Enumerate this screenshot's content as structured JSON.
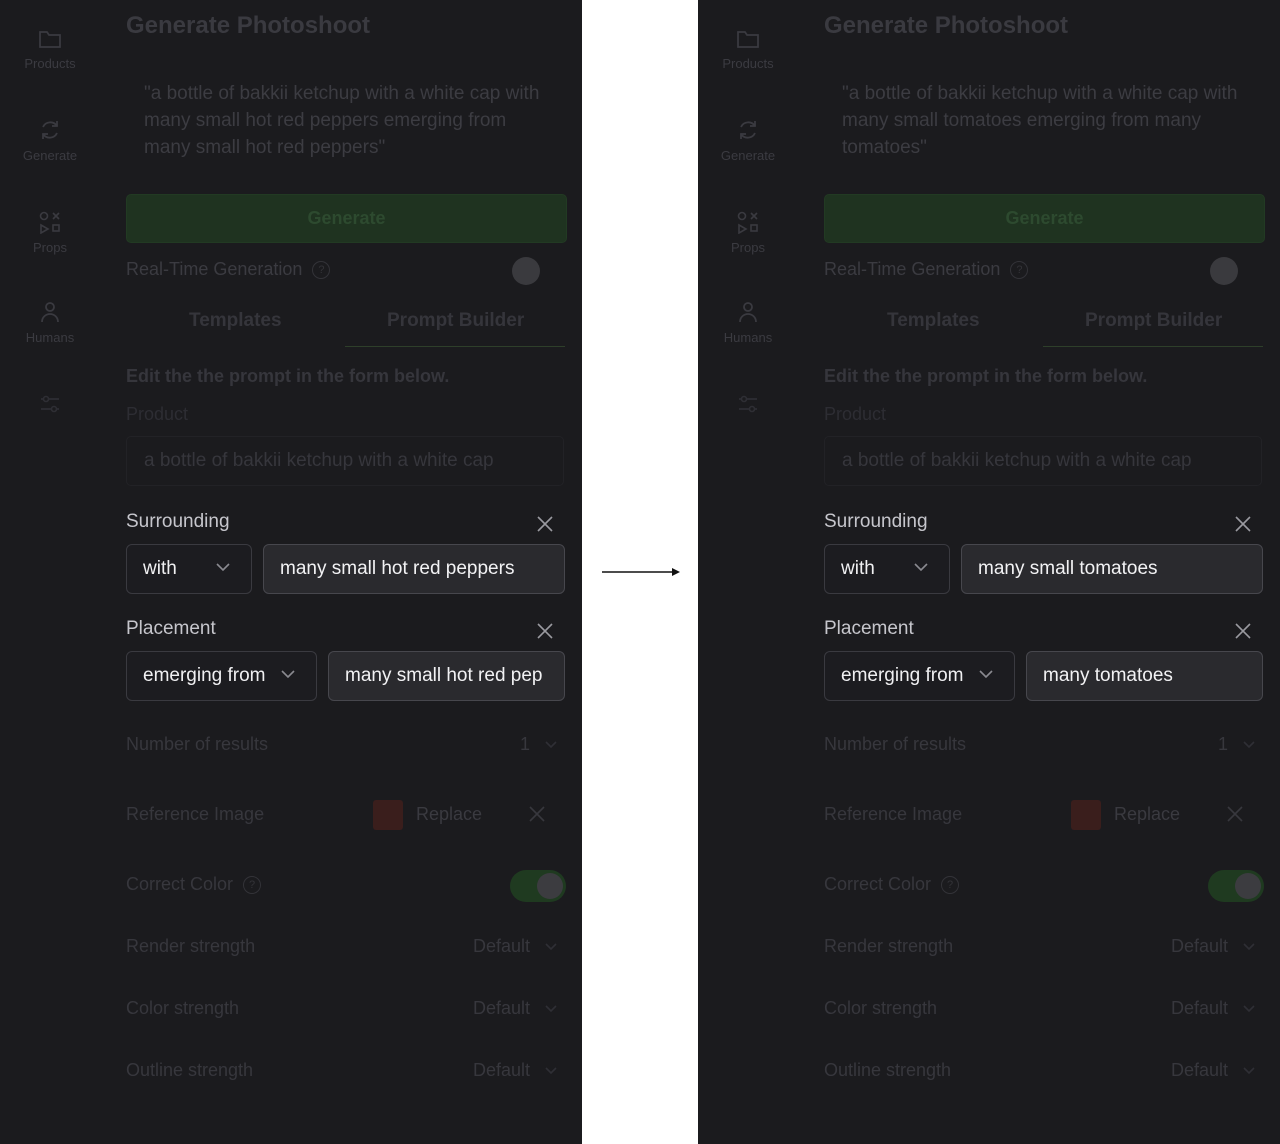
{
  "sidebar": {
    "items": [
      {
        "label": "Products",
        "icon": "folder-icon"
      },
      {
        "label": "Generate",
        "icon": "refresh-icon"
      },
      {
        "label": "Props",
        "icon": "shapes-icon"
      },
      {
        "label": "Humans",
        "icon": "person-icon"
      },
      {
        "label": "",
        "icon": "sliders-icon"
      }
    ]
  },
  "panels": [
    {
      "title": "Generate Photoshoot",
      "prompt": "\"a bottle of bakkii ketchup with a white cap with many small hot red peppers emerging from many small hot red peppers\"",
      "generate_label": "Generate",
      "realtime_label": "Real-Time Generation",
      "help_glyph": "?",
      "tabs": [
        "Templates",
        "Prompt Builder"
      ],
      "edit_hint": "Edit the the prompt in the form below.",
      "product_label": "Product",
      "product_value": "a bottle of bakkii ketchup with a white cap",
      "surrounding": {
        "label": "Surrounding",
        "select": "with",
        "value": "many small hot red peppers"
      },
      "placement": {
        "label": "Placement",
        "select": "emerging from",
        "value": "many small hot red pep"
      },
      "number_of_results": {
        "label": "Number of results",
        "value": "1"
      },
      "reference_image": {
        "label": "Reference Image",
        "action": "Replace"
      },
      "correct_color": {
        "label": "Correct Color"
      },
      "render_strength": {
        "label": "Render strength",
        "value": "Default"
      },
      "color_strength": {
        "label": "Color strength",
        "value": "Default"
      },
      "outline_strength": {
        "label": "Outline strength",
        "value": "Default"
      }
    },
    {
      "title": "Generate Photoshoot",
      "prompt": "\"a bottle of bakkii ketchup with a white cap with many small tomatoes emerging from many tomatoes\"",
      "generate_label": "Generate",
      "realtime_label": "Real-Time Generation",
      "help_glyph": "?",
      "tabs": [
        "Templates",
        "Prompt Builder"
      ],
      "edit_hint": "Edit the the prompt in the form below.",
      "product_label": "Product",
      "product_value": "a bottle of bakkii ketchup with a white cap",
      "surrounding": {
        "label": "Surrounding",
        "select": "with",
        "value": "many small tomatoes"
      },
      "placement": {
        "label": "Placement",
        "select": "emerging from",
        "value": "many tomatoes"
      },
      "number_of_results": {
        "label": "Number of results",
        "value": "1"
      },
      "reference_image": {
        "label": "Reference Image",
        "action": "Replace"
      },
      "correct_color": {
        "label": "Correct Color"
      },
      "render_strength": {
        "label": "Render strength",
        "value": "Default"
      },
      "color_strength": {
        "label": "Color strength",
        "value": "Default"
      },
      "outline_strength": {
        "label": "Outline strength",
        "value": "Default"
      }
    }
  ],
  "colors": {
    "panel_bg": "#1b1b1e",
    "accent_green": "#1f3320",
    "highlight_text": "#f0f0f2"
  }
}
